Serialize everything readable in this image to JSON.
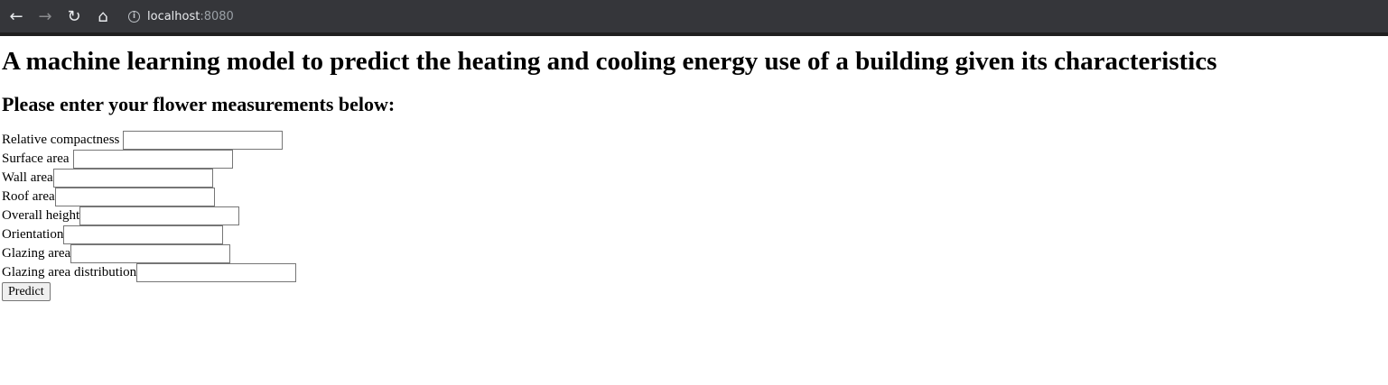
{
  "browser": {
    "url_host": "localhost",
    "url_port": ":8080"
  },
  "page": {
    "title": "A machine learning model to predict the heating and cooling energy use of a building given its characteristics",
    "subtitle": "Please enter your flower measurements below:",
    "fields": [
      {
        "label": "Relative compactness",
        "value": ""
      },
      {
        "label": "Surface area",
        "value": ""
      },
      {
        "label": "Wall area",
        "value": ""
      },
      {
        "label": "Roof area",
        "value": ""
      },
      {
        "label": "Overall height",
        "value": ""
      },
      {
        "label": "Orientation",
        "value": ""
      },
      {
        "label": "Glazing area",
        "value": ""
      },
      {
        "label": "Glazing area distribution",
        "value": ""
      }
    ],
    "predict_label": "Predict"
  }
}
